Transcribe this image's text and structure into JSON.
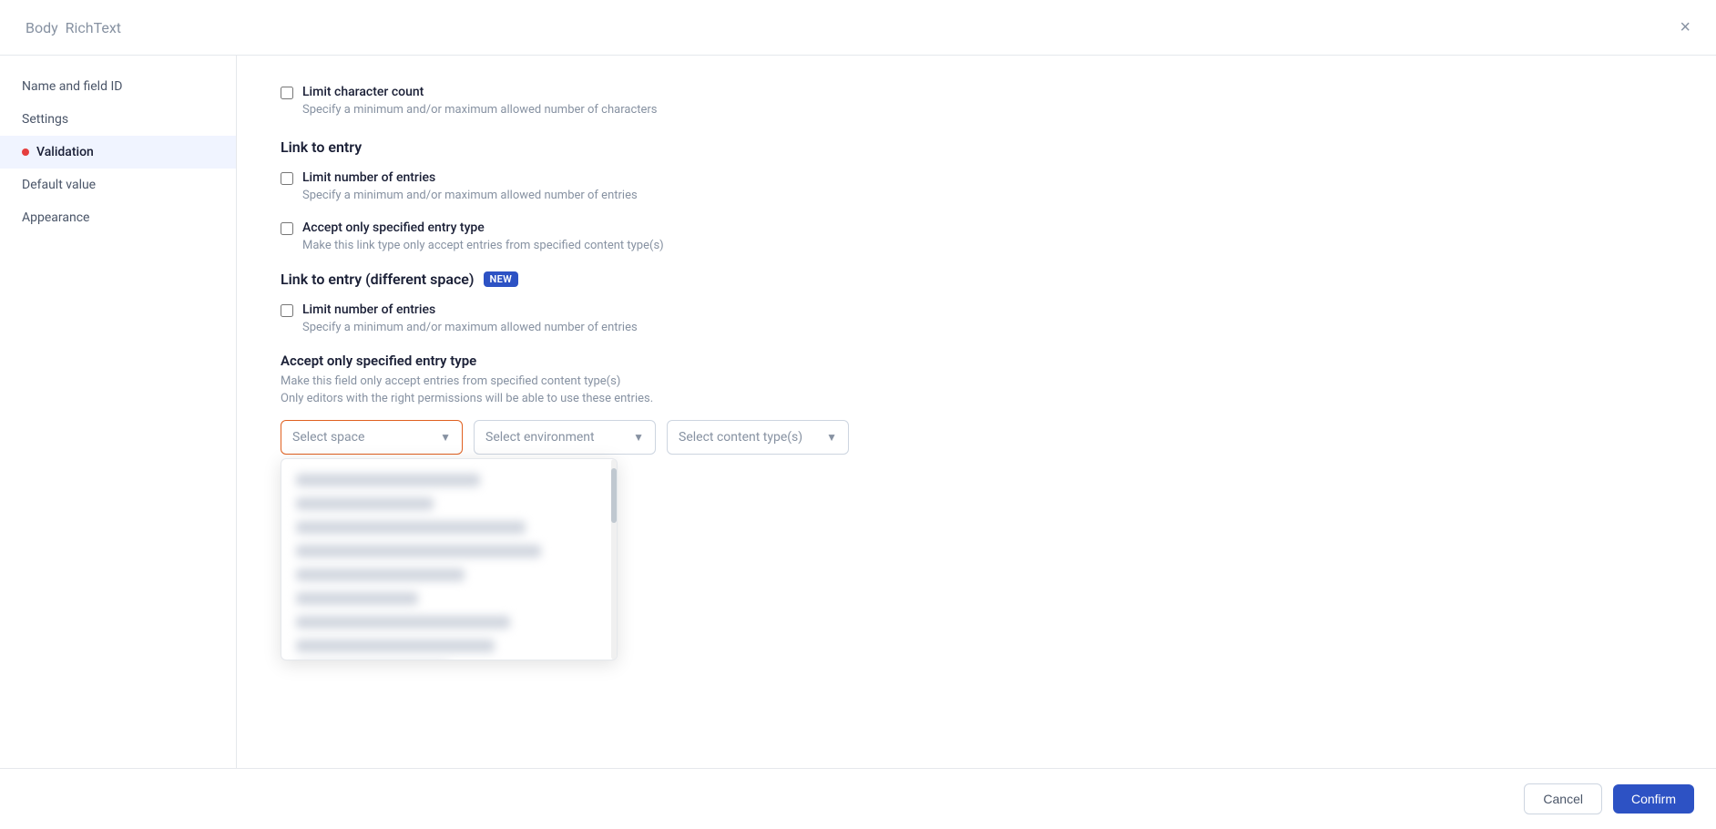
{
  "modal": {
    "title": "Body",
    "subtitle": "RichText",
    "close_label": "×"
  },
  "sidebar": {
    "items": [
      {
        "id": "name-field",
        "label": "Name and field ID",
        "active": false,
        "error": false
      },
      {
        "id": "settings",
        "label": "Settings",
        "active": false,
        "error": false
      },
      {
        "id": "validation",
        "label": "Validation",
        "active": true,
        "error": true
      },
      {
        "id": "default-value",
        "label": "Default value",
        "active": false,
        "error": false
      },
      {
        "id": "appearance",
        "label": "Appearance",
        "active": false,
        "error": false
      }
    ]
  },
  "content": {
    "limit_char": {
      "checkbox_label": "Limit character count",
      "helper": "Specify a minimum and/or maximum allowed number of characters"
    },
    "link_to_entry": {
      "section_title": "Link to entry",
      "limit_entries_label": "Limit number of entries",
      "limit_entries_helper": "Specify a minimum and/or maximum allowed number of entries",
      "accept_entry_label": "Accept only specified entry type",
      "accept_entry_helper": "Make this link type only accept entries from specified content type(s)"
    },
    "link_to_entry_diff": {
      "section_title": "Link to entry (different space)",
      "new_badge": "New",
      "limit_entries_label": "Limit number of entries",
      "limit_entries_helper": "Specify a minimum and/or maximum allowed number of entries"
    },
    "accept_only": {
      "title": "Accept only specified entry type",
      "helper1": "Make this field only accept entries from specified content type(s)",
      "helper2": "Only editors with the right permissions will be able to use these entries."
    },
    "dropdowns": {
      "space": {
        "placeholder": "Select space",
        "options": []
      },
      "environment": {
        "placeholder": "Select environment",
        "options": []
      },
      "content_type": {
        "placeholder": "Select content type(s)",
        "options": []
      }
    }
  },
  "footer": {
    "cancel_label": "Cancel",
    "confirm_label": "Confirm"
  },
  "blurred_items": [
    {
      "width": "60%"
    },
    {
      "width": "45%"
    },
    {
      "width": "75%"
    },
    {
      "width": "80%"
    },
    {
      "width": "55%"
    },
    {
      "width": "40%"
    },
    {
      "width": "65%"
    }
  ]
}
